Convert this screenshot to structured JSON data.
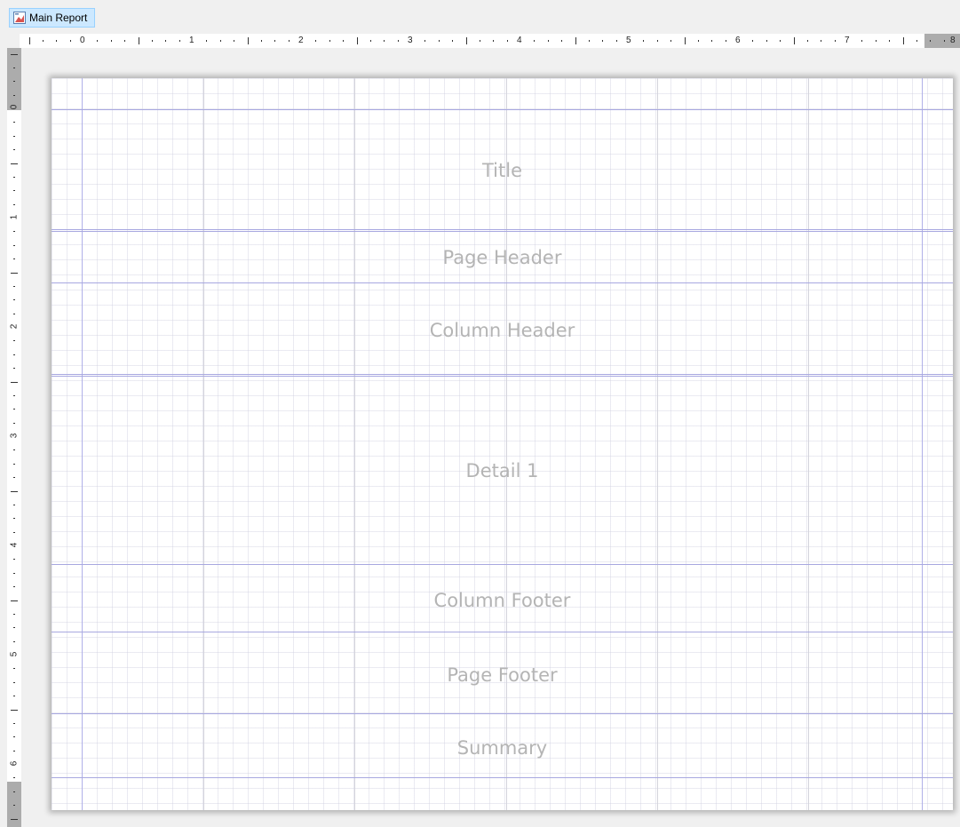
{
  "tab": {
    "label": "Main Report",
    "icon": "report-icon"
  },
  "ruler": {
    "horizontal_numbers": [
      "0",
      "1",
      "2",
      "3",
      "4",
      "5",
      "6",
      "7",
      "8"
    ],
    "vertical_numbers": [
      "0",
      "1",
      "2",
      "3",
      "4",
      "5",
      "6"
    ]
  },
  "bands": [
    {
      "name": "title",
      "label": "Title"
    },
    {
      "name": "page-header",
      "label": "Page Header"
    },
    {
      "name": "column-header",
      "label": "Column Header"
    },
    {
      "name": "detail",
      "label": "Detail 1"
    },
    {
      "name": "column-footer",
      "label": "Column Footer"
    },
    {
      "name": "page-footer",
      "label": "Page Footer"
    },
    {
      "name": "summary",
      "label": "Summary"
    }
  ],
  "colors": {
    "tab_bg": "#cce8ff",
    "band_line": "#a8a8e0",
    "band_label": "#b4b4b4",
    "ruler_shade": "#acacac"
  }
}
